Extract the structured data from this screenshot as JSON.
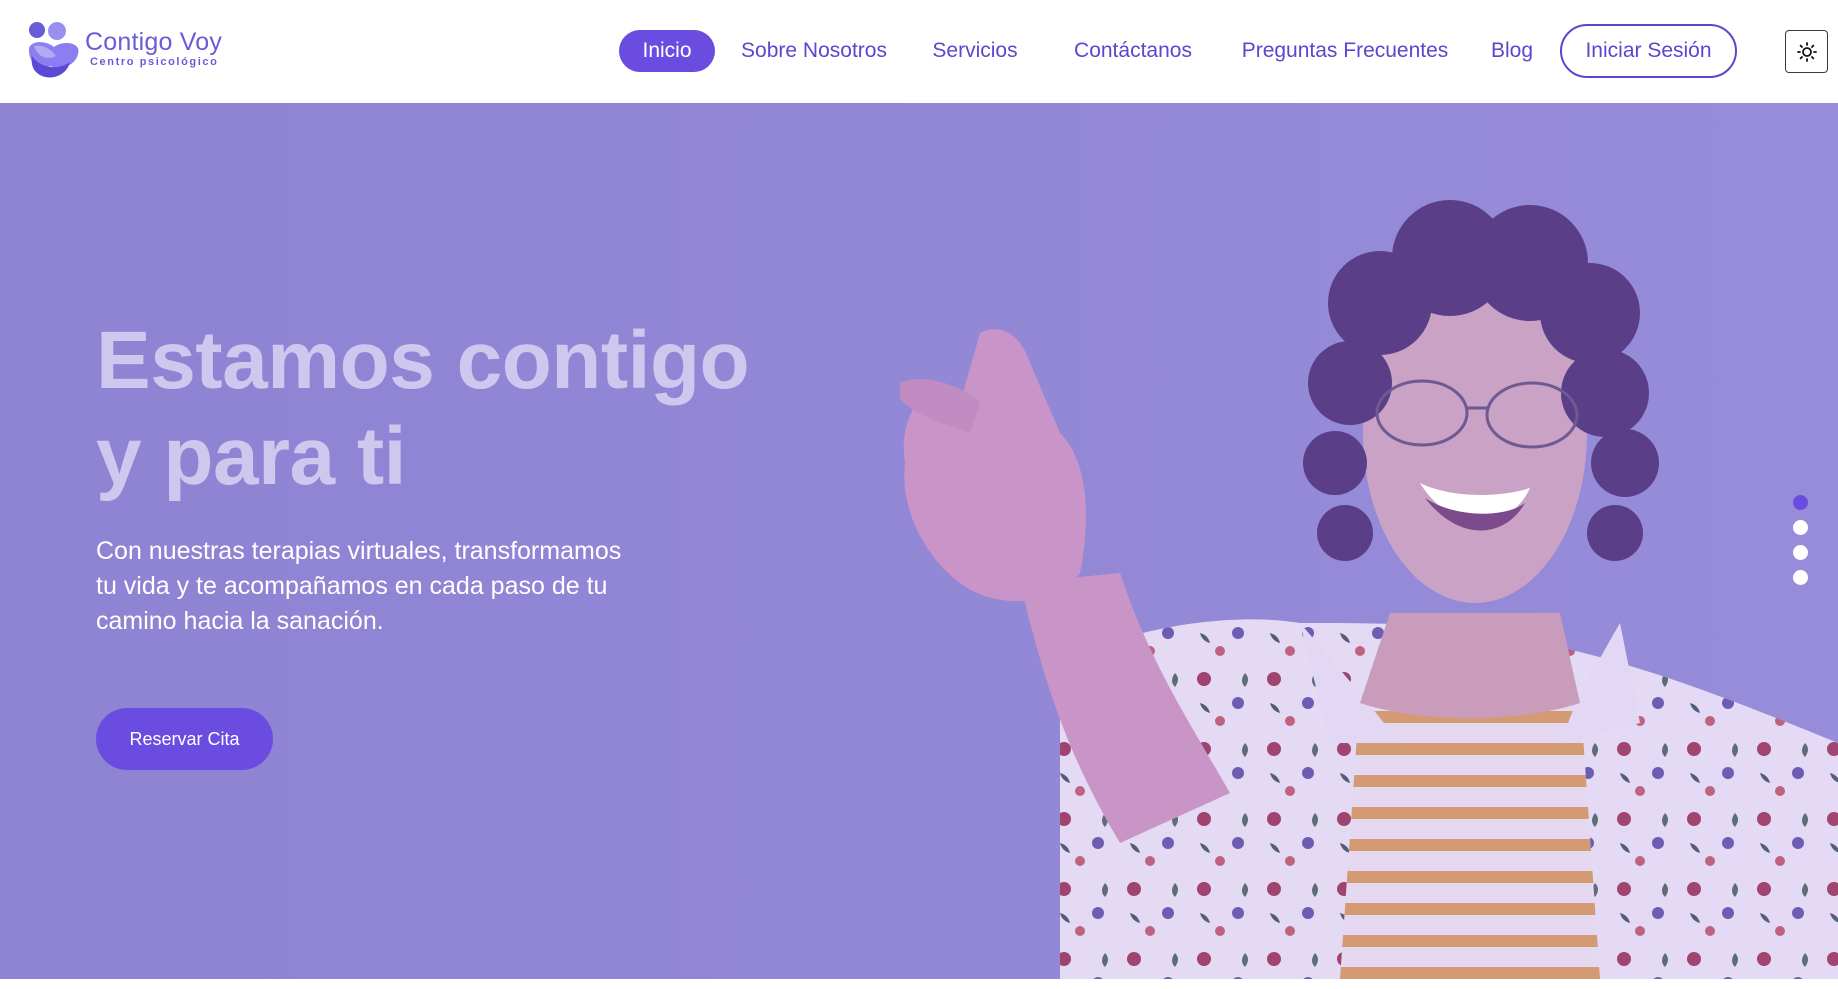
{
  "brand": {
    "name": "Contigo Voy",
    "tagline": "Centro psicológico",
    "colors": {
      "primary": "#6a4de0",
      "logo": "#6a5cd6",
      "hero_overlay": "#9186d6"
    }
  },
  "nav": {
    "items": [
      {
        "label": "Inicio",
        "active": true
      },
      {
        "label": "Sobre Nosotros",
        "active": false
      },
      {
        "label": "Servicios",
        "active": false
      },
      {
        "label": "Contáctanos",
        "active": false
      },
      {
        "label": "Preguntas Frecuentes",
        "active": false
      },
      {
        "label": "Blog",
        "active": false
      }
    ],
    "login_label": "Iniciar Sesión",
    "theme_toggle_icon": "sun-icon"
  },
  "hero": {
    "title_line1": "Estamos contigo",
    "title_line2": "y para ti",
    "text_line1": "Con nuestras terapias virtuales, transformamos",
    "text_line2": "tu vida y te acompañamos en cada paso de tu",
    "text_line3": "camino hacia la sanación.",
    "cta_label": "Reservar Cita",
    "image_icon": "smiling-young-man-photo",
    "carousel": {
      "slides": 4,
      "active_index": 0
    }
  }
}
